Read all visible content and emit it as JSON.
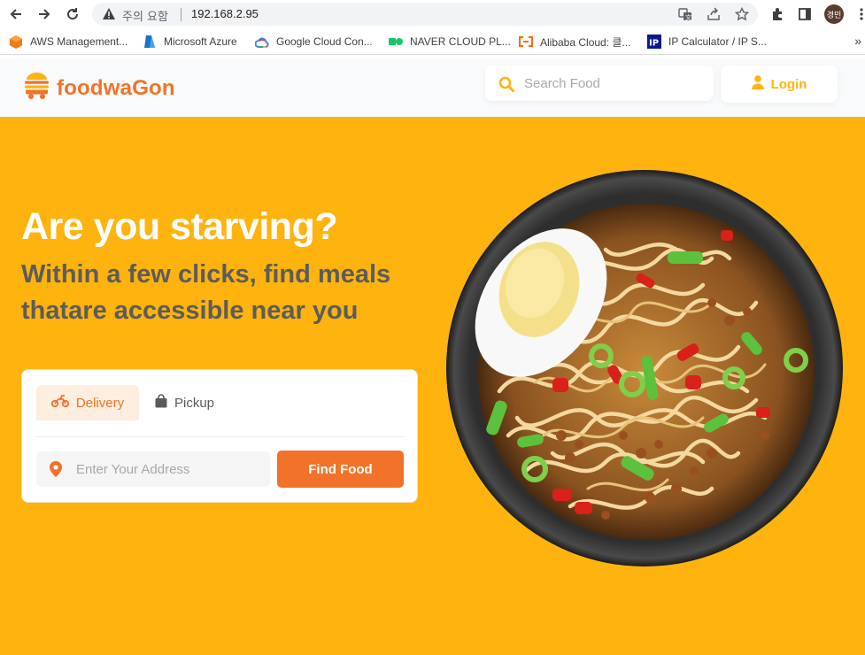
{
  "browser": {
    "warning_text": "주의 요함",
    "url": "192.168.2.95",
    "avatar_initials": "경민",
    "icons": [
      "back-icon",
      "forward-icon",
      "reload-icon",
      "warning-icon",
      "translate-icon",
      "share-icon",
      "star-icon",
      "extensions-icon",
      "side-panel-icon",
      "menu-icon"
    ]
  },
  "bookmarks": [
    {
      "label": "AWS Management...",
      "icon": "aws-icon"
    },
    {
      "label": "Microsoft Azure",
      "icon": "azure-icon"
    },
    {
      "label": "Google Cloud Con...",
      "icon": "google-cloud-icon"
    },
    {
      "label": "NAVER CLOUD PL...",
      "icon": "naver-cloud-icon"
    },
    {
      "label": "Alibaba Cloud: 클...",
      "icon": "alibaba-icon"
    },
    {
      "label": "IP Calculator / IP S...",
      "icon": "ip-calc-icon"
    }
  ],
  "site": {
    "logo_text": "foodwaGon",
    "search_placeholder": "Search Food",
    "login_label": "Login"
  },
  "hero": {
    "title": "Are you starving?",
    "subtitle": "Within a few clicks, find meals thatare accessible near you",
    "tabs": [
      "Delivery",
      "Pickup"
    ],
    "active_tab": "Delivery",
    "address_placeholder": "Enter Your Address",
    "find_button": "Find Food"
  },
  "colors": {
    "brand_orange": "#f17228",
    "hero_yellow": "#ffb30e",
    "subtitle_gray": "#5c5c5c"
  }
}
